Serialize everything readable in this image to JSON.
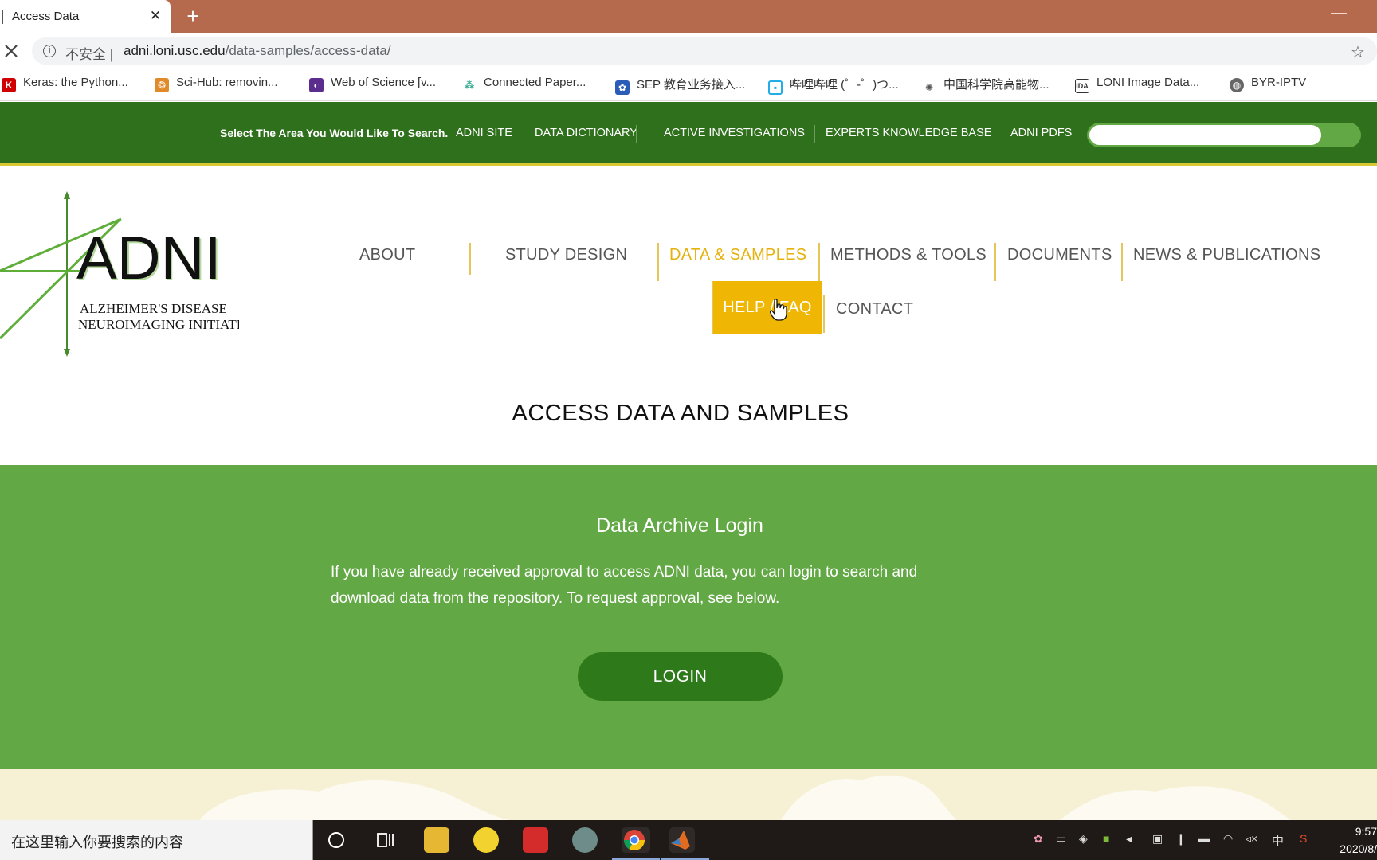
{
  "browser": {
    "tab_title": "Access Data",
    "close_tab_glyph": "✕",
    "new_tab_glyph": "+",
    "insecure_label": "不安全 |",
    "url_host": "adni.loni.usc.edu",
    "url_path": "/data-samples/access-data/",
    "bookmarks": [
      {
        "label": "Keras: the Python...",
        "icon": "keras-icon",
        "color": "#d00000"
      },
      {
        "label": "Sci-Hub: removin...",
        "icon": "scihub-icon",
        "color": "#e08a2a"
      },
      {
        "label": "Web of Science [v...",
        "icon": "wos-icon",
        "color": "#5b2d8e"
      },
      {
        "label": "Connected Paper...",
        "icon": "connectedpapers-icon",
        "color": "#2aa58a"
      },
      {
        "label": "SEP 教育业务接入...",
        "icon": "sep-icon",
        "color": "#2a5cb8"
      },
      {
        "label": "哔哩哔哩 (゜-゜)つ...",
        "icon": "bilibili-icon",
        "color": "#23ade5"
      },
      {
        "label": "中国科学院高能物...",
        "icon": "ihep-icon",
        "color": "#555555"
      },
      {
        "label": "LONI Image Data...",
        "icon": "ida-icon",
        "color": "#333333"
      },
      {
        "label": "BYR-IPTV",
        "icon": "globe-icon",
        "color": "#666666"
      }
    ]
  },
  "sitebar": {
    "prompt": "Select The Area You Would Like To Search.",
    "links": [
      "ADNI SITE",
      "DATA DICTIONARY",
      "ACTIVE INVESTIGATIONS",
      "EXPERTS KNOWLEDGE BASE",
      "ADNI PDFS"
    ],
    "search_placeholder": ""
  },
  "logo": {
    "title": "ADNI",
    "line1": "ALZHEIMER'S DISEASE",
    "line2": "NEUROIMAGING INITIATIVE"
  },
  "nav": {
    "items": [
      "ABOUT",
      "STUDY DESIGN",
      "DATA & SAMPLES",
      "METHODS & TOOLS",
      "DOCUMENTS",
      "NEWS & PUBLICATIONS",
      "HELP / FAQ",
      "CONTACT"
    ],
    "active": "DATA & SAMPLES",
    "hovered": "HELP / FAQ"
  },
  "page": {
    "title": "ACCESS DATA AND SAMPLES"
  },
  "login": {
    "heading": "Data Archive Login",
    "text_line1": "If you have already received approval to access ADNI data, you can login to search and",
    "text_line2": "download data from the repository. To request approval, see below.",
    "button": "LOGIN"
  },
  "taskbar": {
    "search_placeholder": "在这里输入你要搜索的内容",
    "ime": "中",
    "time": "9:57",
    "date": "2020/8/"
  },
  "colors": {
    "tab_bar": "#b5694d",
    "site_green_dark": "#2e701b",
    "site_green": "#62a844",
    "accent_yellow": "#efb603",
    "login_button": "#2e7a1a"
  }
}
